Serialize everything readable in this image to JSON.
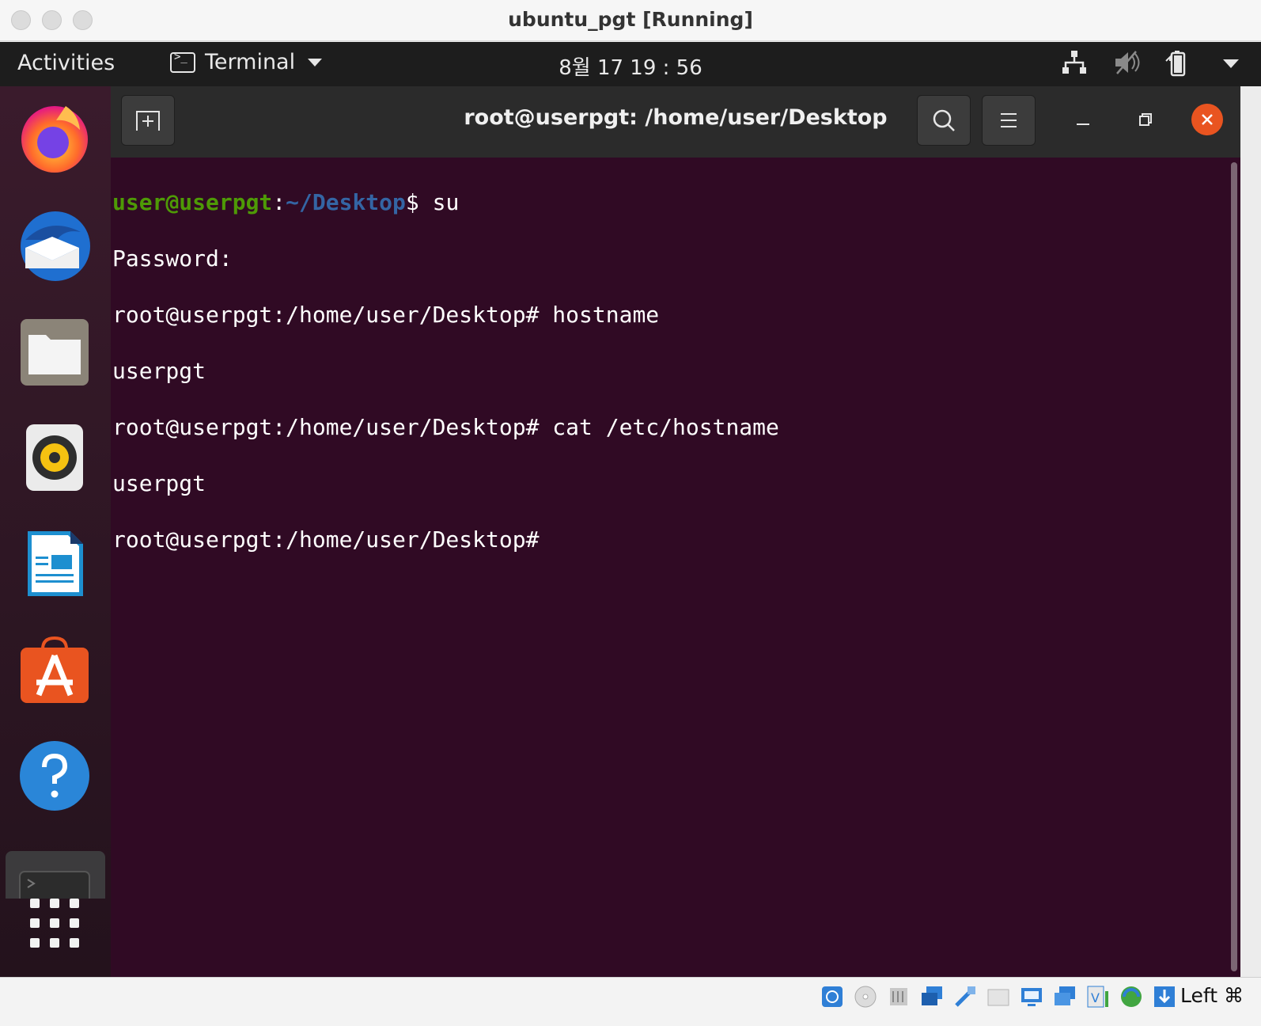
{
  "window": {
    "title": "ubuntu_pgt [Running]"
  },
  "topbar": {
    "activities": "Activities",
    "app_name": "Terminal",
    "clock": "8월 17  19 : 56",
    "tray_icons": [
      "network-icon",
      "volume-muted-icon",
      "battery-icon",
      "system-menu-caret-icon"
    ]
  },
  "dock": {
    "apps": [
      "firefox",
      "thunderbird",
      "files",
      "rhythmbox",
      "libreoffice-writer",
      "ubuntu-software",
      "help",
      "terminal"
    ],
    "show_apps": "show-applications"
  },
  "terminal": {
    "title": "root@userpgt: /home/user/Desktop",
    "lines": [
      {
        "user": "user@userpgt",
        "sep": ":",
        "path": "~/Desktop",
        "tail": "$ su"
      },
      {
        "text": "Password:"
      },
      {
        "text": "root@userpgt:/home/user/Desktop# hostname"
      },
      {
        "text": "userpgt"
      },
      {
        "text": "root@userpgt:/home/user/Desktop# cat /etc/hostname"
      },
      {
        "text": "userpgt"
      },
      {
        "text": "root@userpgt:/home/user/Desktop# "
      }
    ]
  },
  "statusbar": {
    "host_key": "Left ⌘"
  },
  "colors": {
    "terminal_bg": "#300a24",
    "prompt_user": "#4e9a06",
    "prompt_path": "#3465a4",
    "close_button": "#e95420"
  }
}
